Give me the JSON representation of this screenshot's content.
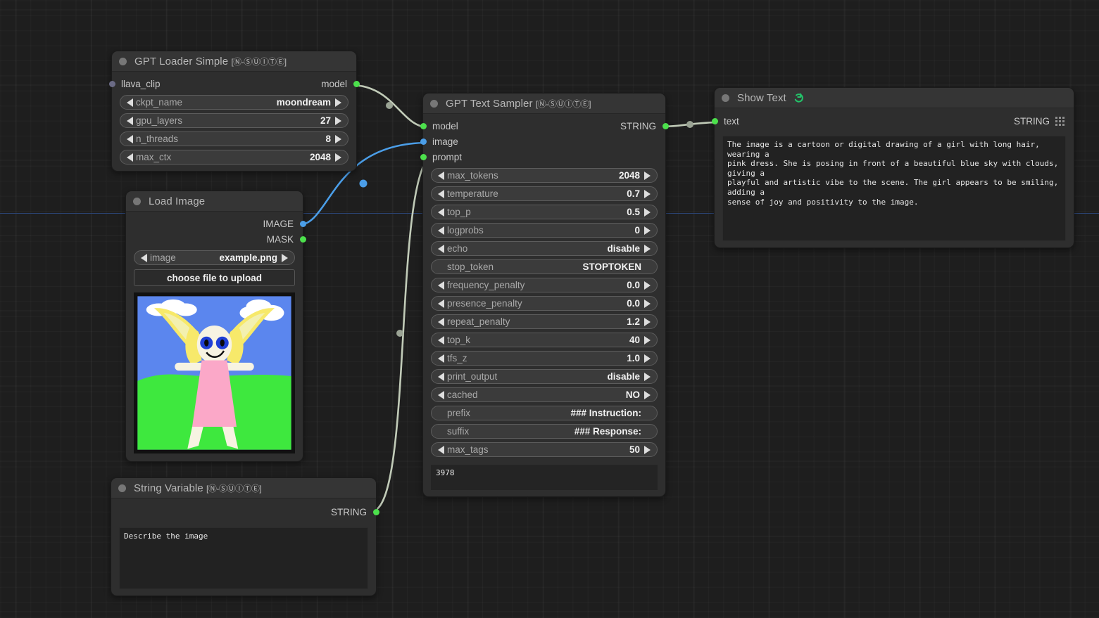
{
  "app": {
    "background_color": "#1e1e1e",
    "grid_color": "#2a2a2a",
    "axis_color": "#2b4372",
    "wire_color_default": "#c1cbb8",
    "wire_color_image": "#4b9ee8"
  },
  "suite_tag": "[Ⓝ-ⓈⓊⒾⓉⒺ]",
  "nodes": {
    "loader": {
      "title": "GPT Loader Simple ",
      "suite": "[Ⓝ-ⓈⓊⒾⓉⒺ]",
      "inputs": [
        {
          "label": "llava_clip",
          "color": "#6b6b85"
        }
      ],
      "outputs": [
        {
          "label": "model",
          "color": "#4ce04c"
        }
      ],
      "widgets": [
        {
          "name": "ckpt_name",
          "value": "moondream",
          "arrows": true
        },
        {
          "name": "gpu_layers",
          "value": "27",
          "arrows": true
        },
        {
          "name": "n_threads",
          "value": "8",
          "arrows": true
        },
        {
          "name": "max_ctx",
          "value": "2048",
          "arrows": true
        }
      ]
    },
    "load_image": {
      "title": "Load Image",
      "outputs": [
        {
          "label": "IMAGE",
          "color": "#4b9ee8"
        },
        {
          "label": "MASK",
          "color": "#4ce04c"
        }
      ],
      "widgets": [
        {
          "name": "image",
          "value": "example.png",
          "arrows": true
        }
      ],
      "upload_button": "choose file to upload",
      "preview_alt": "child-style drawing of a girl with long blonde hair in a pink dress, blue sky with clouds and green grass"
    },
    "string_variable": {
      "title": "String Variable ",
      "suite": "[Ⓝ-ⓈⓊⒾⓉⒺ]",
      "outputs": [
        {
          "label": "STRING",
          "color": "#4ce04c"
        }
      ],
      "text": "Describe the image"
    },
    "sampler": {
      "title": "GPT Text Sampler ",
      "suite": "[Ⓝ-ⓈⓊⒾⓉⒺ]",
      "inputs": [
        {
          "label": "model",
          "color": "#4ce04c"
        },
        {
          "label": "image",
          "color": "#4b9ee8"
        },
        {
          "label": "prompt",
          "color": "#4ce04c"
        }
      ],
      "outputs": [
        {
          "label": "STRING",
          "color": "#4ce04c"
        }
      ],
      "widgets": [
        {
          "name": "max_tokens",
          "value": "2048",
          "arrows": true
        },
        {
          "name": "temperature",
          "value": "0.7",
          "arrows": true
        },
        {
          "name": "top_p",
          "value": "0.5",
          "arrows": true
        },
        {
          "name": "logprobs",
          "value": "0",
          "arrows": true
        },
        {
          "name": "echo",
          "value": "disable",
          "arrows": true
        },
        {
          "name": "stop_token",
          "value": "STOPTOKEN",
          "arrows": false
        },
        {
          "name": "frequency_penalty",
          "value": "0.0",
          "arrows": true
        },
        {
          "name": "presence_penalty",
          "value": "0.0",
          "arrows": true
        },
        {
          "name": "repeat_penalty",
          "value": "1.2",
          "arrows": true
        },
        {
          "name": "top_k",
          "value": "40",
          "arrows": true
        },
        {
          "name": "tfs_z",
          "value": "1.0",
          "arrows": true
        },
        {
          "name": "print_output",
          "value": "disable",
          "arrows": true
        },
        {
          "name": "cached",
          "value": "NO",
          "arrows": true
        },
        {
          "name": "prefix",
          "value": "### Instruction:",
          "arrows": false
        },
        {
          "name": "suffix",
          "value": "### Response:",
          "arrows": false
        },
        {
          "name": "max_tags",
          "value": "50",
          "arrows": true
        }
      ],
      "console": "3978"
    },
    "show_text": {
      "title": "Show Text",
      "refresh_icon": "refresh-icon",
      "inputs": [
        {
          "label": "text",
          "color": "#4ce04c"
        }
      ],
      "type_label": "STRING",
      "text": "The image is a cartoon or digital drawing of a girl with long hair, wearing a\npink dress. She is posing in front of a beautiful blue sky with clouds, giving a\nplayful and artistic vibe to the scene. The girl appears to be smiling, adding a\nsense of joy and positivity to the image."
    }
  }
}
